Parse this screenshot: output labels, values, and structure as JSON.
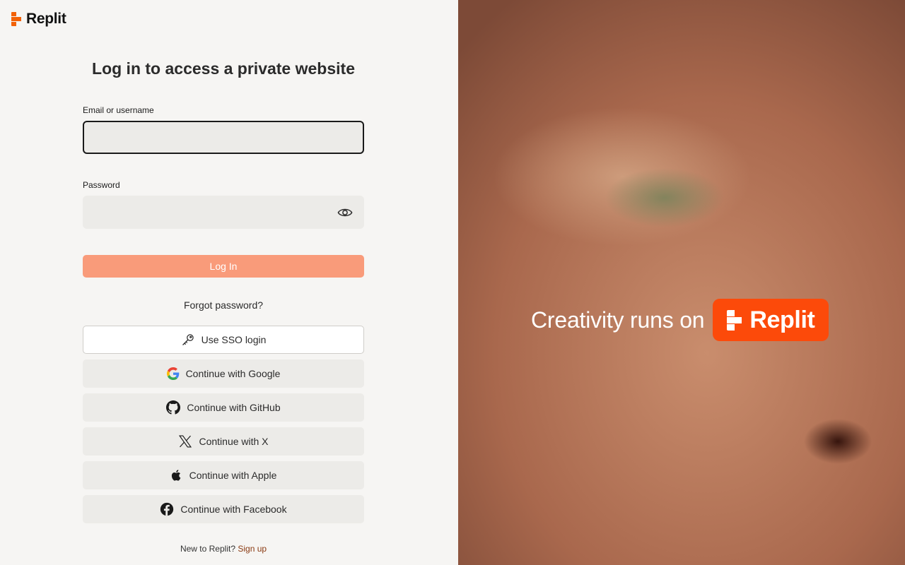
{
  "brand": {
    "name": "Replit",
    "accent": "#f26207"
  },
  "title": "Log in to access a private website",
  "email": {
    "label": "Email or username",
    "value": "",
    "placeholder": ""
  },
  "password": {
    "label": "Password",
    "value": "",
    "placeholder": ""
  },
  "login_button": "Log In",
  "forgot_link": "Forgot password?",
  "providers": [
    {
      "label": "Use SSO login",
      "icon": "key-icon"
    },
    {
      "label": "Continue with Google",
      "icon": "google-icon"
    },
    {
      "label": "Continue with GitHub",
      "icon": "github-icon"
    },
    {
      "label": "Continue with X",
      "icon": "x-icon"
    },
    {
      "label": "Continue with Apple",
      "icon": "apple-icon"
    },
    {
      "label": "Continue with Facebook",
      "icon": "facebook-icon"
    }
  ],
  "signup": {
    "prompt": "New to Replit?",
    "link": "Sign up"
  },
  "hero": {
    "tagline": "Creativity runs on",
    "badge": "Replit",
    "badge_color": "#fc4a0a"
  }
}
